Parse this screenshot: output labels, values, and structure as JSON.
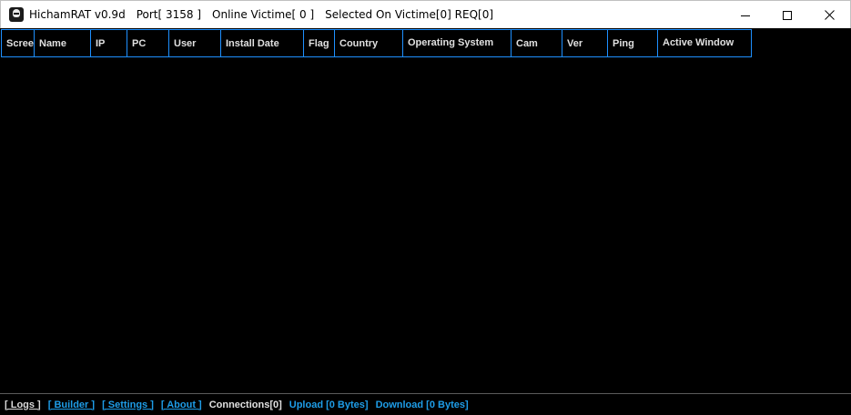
{
  "window": {
    "app_title": "HichamRAT v0.9d",
    "port": "Port[ 3158 ]",
    "online": "Online Victime[ 0 ]",
    "selected": "Selected On Victime[0] REQ[0]",
    "icon": "app-mask-icon",
    "controls": {
      "minimize_icon": "minimize-icon",
      "maximize_icon": "maximize-icon",
      "close_icon": "close-icon"
    }
  },
  "grid": {
    "columns": [
      "Screen",
      "Name",
      "IP",
      "PC",
      "User",
      "Install Date",
      "Flag",
      "Country",
      "Operating System",
      "Cam",
      "Ver",
      "Ping",
      "Active Window"
    ],
    "rows": []
  },
  "status": {
    "logs": "[ Logs ]",
    "builder": "[ Builder ]",
    "settings": "[ Settings ]",
    "about": "[ About ]",
    "connections": "Connections[0]",
    "upload": "Upload [0 Bytes]",
    "download": "Download [0 Bytes]"
  },
  "colors": {
    "accent": "#1e90ff",
    "link": "#1e9de8",
    "background": "#000000"
  }
}
